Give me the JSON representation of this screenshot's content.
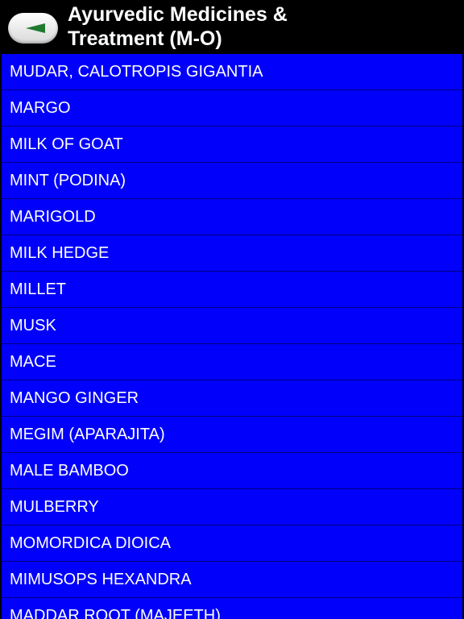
{
  "header": {
    "title": "Ayurvedic Medicines &\nTreatment (M-O)",
    "back_icon": "back-arrow-icon"
  },
  "colors": {
    "header_bg": "#000000",
    "row_bg": "#0000FB",
    "row_text": "#FFFFFF",
    "title_text": "#FFFFFF"
  },
  "list": {
    "items": [
      "MUDAR, CALOTROPIS GIGANTIA",
      "MARGO",
      "MILK OF GOAT",
      "MINT (PODINA)",
      "MARIGOLD",
      "MILK HEDGE",
      "MILLET",
      "MUSK",
      "MACE",
      "MANGO GINGER",
      "MEGIM (APARAJITA)",
      "MALE BAMBOO",
      "MULBERRY",
      "MOMORDICA DIOICA",
      "MIMUSOPS HEXANDRA",
      "MADDAR ROOT (MAJEETH)"
    ]
  }
}
